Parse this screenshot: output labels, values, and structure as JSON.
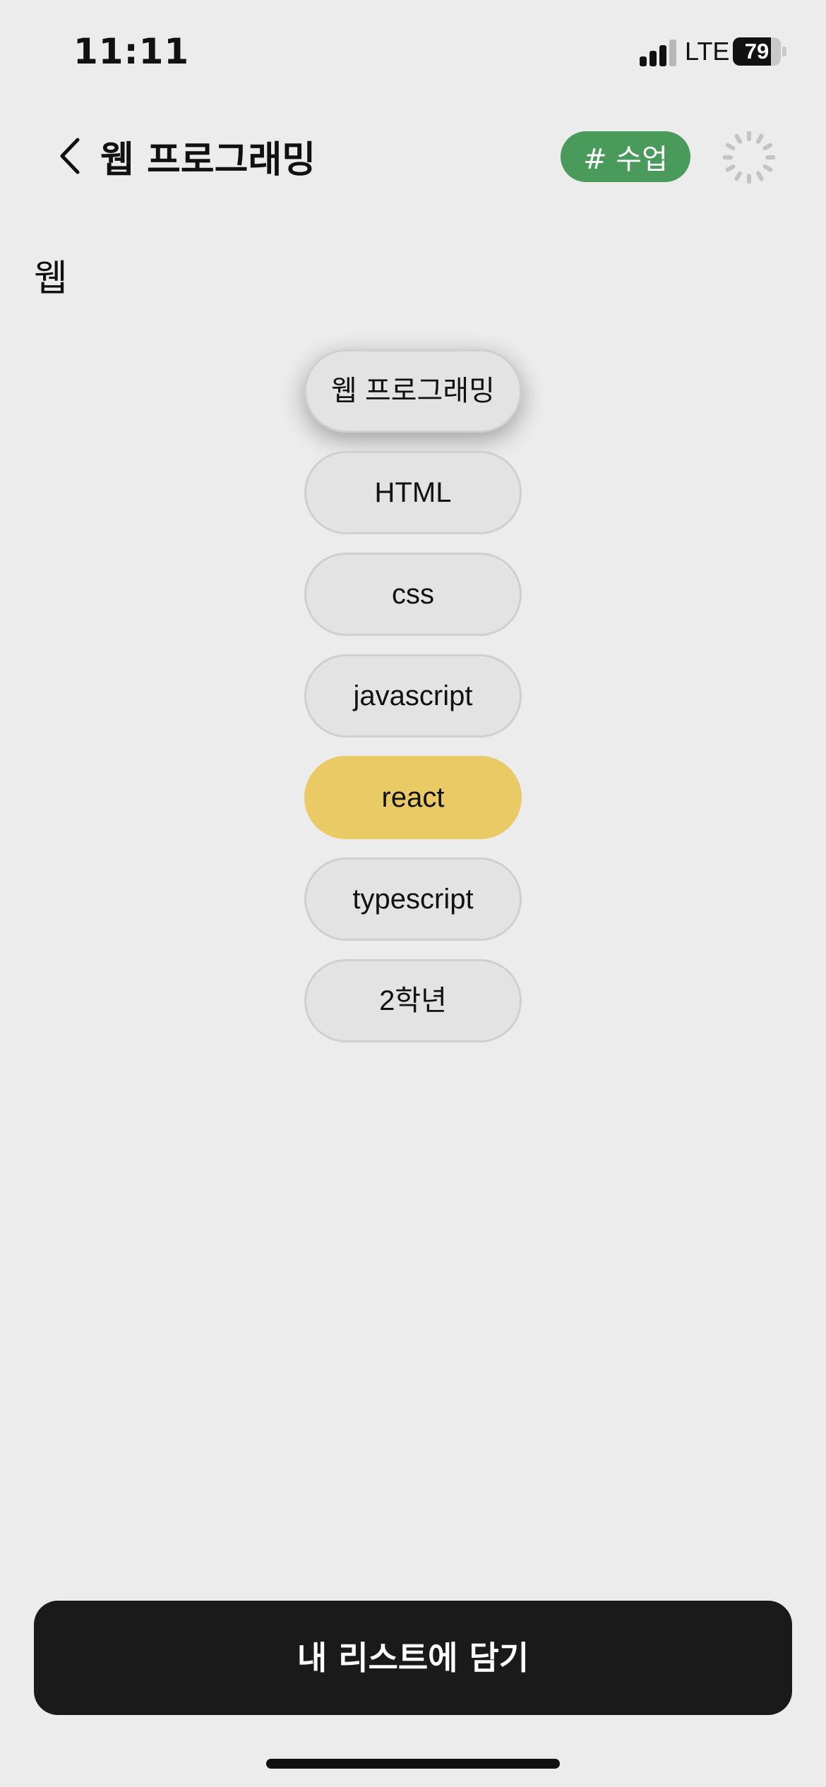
{
  "status_bar": {
    "time": "11:11",
    "network": "LTE",
    "battery_level": "79",
    "signal_bars_active": 3,
    "signal_bars_total": 4
  },
  "header": {
    "back_icon": "chevron-left-icon",
    "title": "웹 프로그래밍",
    "tag_label": "# 수업",
    "tag_color": "#4a9b5b",
    "spinner_icon": "loading-spinner-icon"
  },
  "section": {
    "label": "웹"
  },
  "chips": [
    {
      "label": "웹 프로그래밍",
      "state": "raised"
    },
    {
      "label": "HTML",
      "state": "default"
    },
    {
      "label": "css",
      "state": "default"
    },
    {
      "label": "javascript",
      "state": "default"
    },
    {
      "label": "react",
      "state": "selected"
    },
    {
      "label": "typescript",
      "state": "default"
    },
    {
      "label": "2학년",
      "state": "default"
    }
  ],
  "colors": {
    "background": "#ececec",
    "chip_default": "#e3e3e3",
    "chip_selected": "#eaca64",
    "cta_background": "#1a1a1a"
  },
  "cta": {
    "label": "내 리스트에 담기"
  }
}
